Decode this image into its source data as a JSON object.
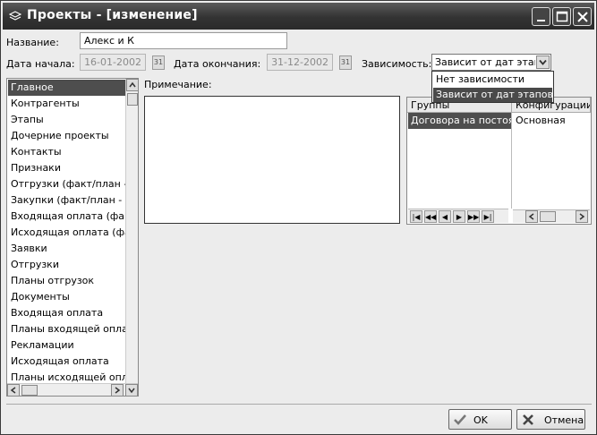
{
  "window": {
    "title": "Проекты - [изменение]"
  },
  "form": {
    "name_label": "Название:",
    "name_value": "Алекс и К",
    "start_label": "Дата начала:",
    "start_value": "16-01-2002",
    "end_label": "Дата окончания:",
    "end_value": "31-12-2002",
    "dependency_label": "Зависимость:",
    "dependency_value": "Зависит от дат этапов",
    "dependency_options": [
      "Нет зависимости",
      "Зависит от дат этапов"
    ],
    "note_label": "Примечание:"
  },
  "nav": {
    "items": [
      "Главное",
      "Контрагенты",
      "Этапы",
      "Дочерние проекты",
      "Контакты",
      "Признаки",
      "Отгрузки (факт/план - об",
      "Закупки (факт/план - об",
      "Входящая оплата (факт/п",
      "Исходящая оплата (факт",
      "Заявки",
      "Отгрузки",
      "Планы отгрузок",
      "Документы",
      "Входящая оплата",
      "Планы входящей оплаты",
      "Рекламации",
      "Исходящая оплата",
      "Планы исходящей оплат"
    ],
    "selected_index": 0
  },
  "grid": {
    "columns": [
      "Группы",
      "Конфигурации"
    ],
    "rows": [
      [
        "Договора на постоянн",
        "Основная"
      ]
    ]
  },
  "buttons": {
    "ok": "OK",
    "cancel": "Отмена"
  },
  "icons": [
    "app-icon",
    "minimize-icon",
    "maximize-icon",
    "close-icon",
    "calendar-icon",
    "chevron-down-icon",
    "check-icon",
    "cross-icon"
  ]
}
